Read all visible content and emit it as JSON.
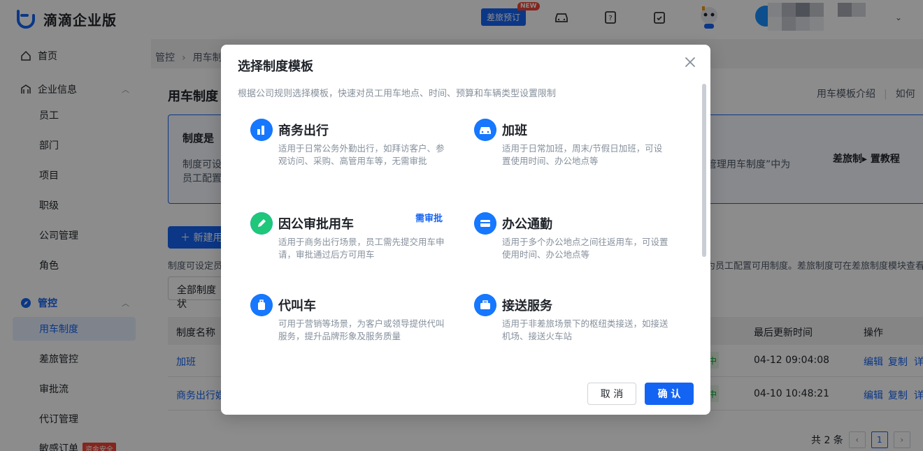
{
  "app": {
    "name": "滴滴企业版"
  },
  "header": {
    "travel_button": "差旅预订",
    "new_badge": "NEW"
  },
  "sidebar": {
    "home": "首页",
    "enterprise_info": "企业信息",
    "enterprise_items": [
      "员工",
      "部门",
      "项目",
      "职级",
      "公司管理",
      "角色"
    ],
    "control": "管控",
    "control_items": [
      "用车制度",
      "差旅管控",
      "审批流",
      "代订管理",
      "敏感订单"
    ],
    "sensitive_tag": "资金安全"
  },
  "breadcrumb": {
    "level1": "管控",
    "sep": "›",
    "level2": "用车制"
  },
  "page": {
    "title": "用车制度",
    "links": {
      "intro": "用车模板介绍",
      "divider": "|",
      "howto": "如何"
    },
    "notice": {
      "title": "制度是",
      "line1": "制度可设",
      "line2": "员工配置",
      "right_text": "管理用车制度”中为",
      "tutorial": "差旅制▸ 置教程"
    },
    "new_button": "＋ 新建用",
    "desc_left": "制度可设定员",
    "desc_right": "为员工配置可用制度。差旅制度可在差旅制度模块查看",
    "filter": "全部制度状"
  },
  "table": {
    "headers": {
      "name": "制度名称",
      "updated": "最后更新时间",
      "actions": "操作"
    },
    "rows": [
      {
        "name": "加班",
        "status": "中",
        "updated": "04-12 09:04:08",
        "edit": "编辑",
        "copy": "复制",
        "detail": "详"
      },
      {
        "name": "商务出行娱",
        "status": "中",
        "updated": "04-10 10:48:21",
        "edit": "编辑",
        "copy": "复制",
        "detail": "详"
      }
    ]
  },
  "pager": {
    "total": "共 2 条",
    "prev": "‹",
    "current": "1",
    "next": "›"
  },
  "modal": {
    "title": "选择制度模板",
    "subtitle": "根据公司规则选择模板，快速对员工用车地点、时间、预算和车辆类型设置限制",
    "templates": [
      {
        "name": "商务出行",
        "desc": "适用于日常公务外勤出行，如拜访客户、参观访问、采购、高管用车等，无需审批",
        "icon": "chart-icon",
        "tag": ""
      },
      {
        "name": "加班",
        "desc": "适用于日常加班，周末/节假日加班，可设置使用时间、办公地点等",
        "icon": "car-icon",
        "tag": ""
      },
      {
        "name": "因公审批用车",
        "desc": "适用于商务出行场景，员工需先提交用车申请，审批通过后方可用车",
        "icon": "pencil-icon",
        "tag": "需审批"
      },
      {
        "name": "办公通勤",
        "desc": "适用于多个办公地点之间往返用车，可设置使用时间、办公地点等",
        "icon": "card-icon",
        "tag": ""
      },
      {
        "name": "代叫车",
        "desc": "可用于营销等场景，为客户或领导提供代叫服务，提升品牌形象及服务质量",
        "icon": "luggage-icon",
        "tag": ""
      },
      {
        "name": "接送服务",
        "desc": "适用于非差旅场景下的枢纽类接送，如接送机场、接送火车站",
        "icon": "briefcase-icon",
        "tag": ""
      }
    ],
    "cancel": "取 消",
    "confirm": "确 认"
  },
  "colors": {
    "brand": "#1464f4",
    "green": "#1ec77a",
    "badge_red": "#f04438"
  }
}
